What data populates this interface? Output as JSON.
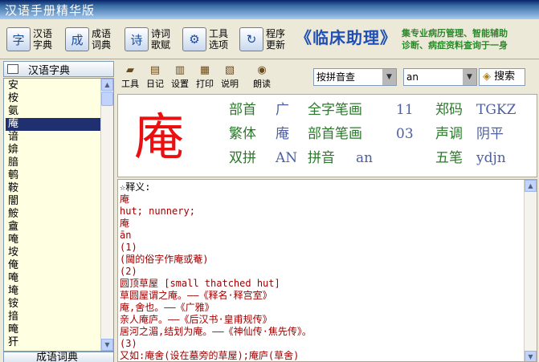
{
  "window": {
    "title": "汉语手册精华版"
  },
  "toolbar": {
    "buttons": [
      {
        "label": "汉语字典",
        "icon": "dictionary-icon",
        "glyph": "字"
      },
      {
        "label": "成语词典",
        "icon": "idiom-book-icon",
        "glyph": "成"
      },
      {
        "label": "诗词歌赋",
        "icon": "poetry-icon",
        "glyph": "诗"
      },
      {
        "label": "工具选项",
        "icon": "tools-icon",
        "glyph": "⚙"
      },
      {
        "label": "程序更新",
        "icon": "update-icon",
        "glyph": "↻"
      }
    ],
    "banner": "《临床助理》",
    "banner_sub_1": "集专业病历管理、智能辅助",
    "banner_sub_2": "诊断、病症资料查询于一身"
  },
  "left_panel": {
    "header": "汉语字典",
    "footer": "成语词典",
    "items": [
      "安",
      "桉",
      "氨",
      "庵",
      "谙",
      "媕",
      "腤",
      "鹌",
      "鞍",
      "闇",
      "鮟",
      "盦",
      "唵",
      "垵",
      "俺",
      "唵",
      "埯",
      "铵",
      "揞",
      "晻",
      "犴"
    ],
    "selected_index": 3
  },
  "subtoolbar": {
    "buttons": [
      {
        "label": "工具",
        "icon": "folder-icon"
      },
      {
        "label": "日记",
        "icon": "diary-icon"
      },
      {
        "label": "设置",
        "icon": "settings-icon"
      },
      {
        "label": "打印",
        "icon": "print-icon"
      },
      {
        "label": "说明",
        "icon": "help-book-icon"
      },
      {
        "label": "朗读",
        "icon": "speaker-icon"
      }
    ],
    "mode_select": "按拼音查",
    "query_input": "an",
    "search_label": "搜索"
  },
  "char_info": {
    "character": "庵",
    "bushou_label": "部首",
    "bushou": "广",
    "total_strokes_label": "全字笔画",
    "total_strokes": "11",
    "zhengma_label": "郑码",
    "zhengma": "TGKZ",
    "traditional_label": "繁体",
    "traditional": "庵",
    "radical_strokes_label": "部首笔画",
    "radical_strokes": "03",
    "tone_label": "声调",
    "tone": "阴平",
    "shuangpin_label": "双拼",
    "shuangpin": "AN",
    "pinyin_label": "拼音",
    "pinyin": "an",
    "wubi_label": "五笔",
    "wubi": "ydjn"
  },
  "definition": {
    "lines": [
      "☆释义:",
      "庵",
      "hut;  nunnery;",
      "庵",
      "ān",
      "(1)",
      "(閫的俗字作庵或菴)",
      "(2)",
      "圆顶草屋 [small thatched hut]",
      "草圆屋谓之庵。——《释名·释宫室》",
      "庵,舍也。——《广雅》",
      "亲人庵庐。——《后汉书·皇甫规传》",
      "居河之湄,结划为庵。——《神仙传·焦先传》。",
      "(3)",
      "又如:庵舍(设在墓旁的草屋);庵庐(草舍)"
    ]
  }
}
